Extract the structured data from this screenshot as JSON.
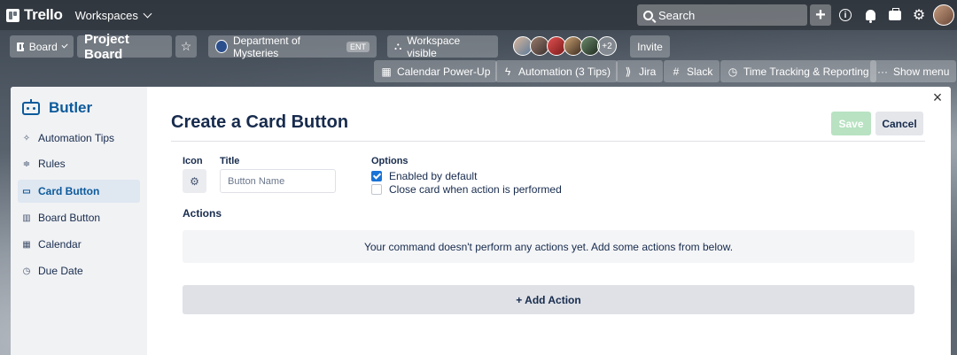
{
  "topnav": {
    "logo": "Trello",
    "workspaces": "Workspaces",
    "search": "Search"
  },
  "board": {
    "view_label": "Board",
    "title": "Project Board",
    "workspace": "Department of Mysteries",
    "workspace_badge": "ENT",
    "visibility": "Workspace visible",
    "more_members": "+2",
    "invite": "Invite"
  },
  "powerups": [
    {
      "label": "Calendar Power-Up",
      "icon": "calendar-icon"
    },
    {
      "label": "Automation (3 Tips)",
      "icon": "lightning-icon"
    },
    {
      "label": "Jira",
      "icon": "jira-icon"
    },
    {
      "label": "Slack",
      "icon": "slack-icon"
    },
    {
      "label": "Time Tracking & Reporting",
      "icon": "timer-icon"
    },
    {
      "label": "Show menu",
      "icon": "more-icon"
    }
  ],
  "sidebar": {
    "title": "Butler",
    "items": [
      {
        "label": "Automation Tips",
        "icon": "sparkle-icon"
      },
      {
        "label": "Rules",
        "icon": "sliders-icon"
      },
      {
        "label": "Card Button",
        "icon": "card-icon"
      },
      {
        "label": "Board Button",
        "icon": "board-icon"
      },
      {
        "label": "Calendar",
        "icon": "calendar-icon"
      },
      {
        "label": "Due Date",
        "icon": "clock-icon"
      }
    ]
  },
  "form": {
    "title": "Create a Card Button",
    "save": "Save",
    "cancel": "Cancel",
    "icon_label": "Icon",
    "title_label": "Title",
    "title_placeholder": "Button Name",
    "options_label": "Options",
    "option_enabled": "Enabled by default",
    "option_close": "Close card when action is performed",
    "actions_label": "Actions",
    "empty_message": "Your command doesn't perform any actions yet. Add some actions from below.",
    "add_action": "+ Add Action"
  },
  "colors": {
    "accent": "#0c5a9b",
    "save_disabled": "#b8e2c1",
    "checkbox": "#1a73d6"
  }
}
